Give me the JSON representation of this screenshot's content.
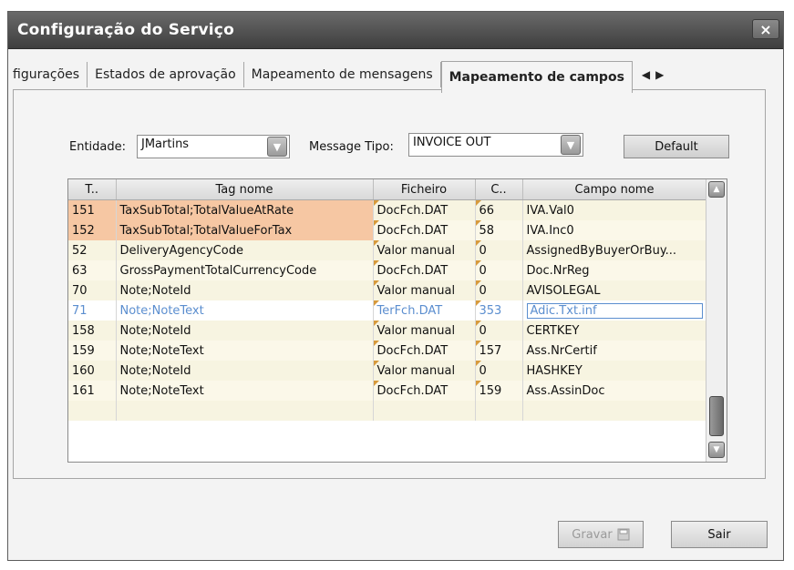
{
  "window": {
    "title": "Configuração do Serviço",
    "close_label": "×"
  },
  "tabs": [
    {
      "label": "figurações"
    },
    {
      "label": "Estados de aprovação"
    },
    {
      "label": "Mapeamento de mensagens"
    },
    {
      "label": "Mapeamento de campos",
      "active": true
    }
  ],
  "tab_scroll": {
    "left": "◀",
    "right": "▶"
  },
  "form": {
    "entidade_label": "Entidade:",
    "entidade_value": "JMartins",
    "message_tipo_label": "Message Tipo:",
    "message_tipo_value": "INVOICE OUT",
    "default_label": "Default"
  },
  "grid": {
    "columns": [
      "T..",
      "Tag nome",
      "Ficheiro",
      "C..",
      "Campo nome"
    ],
    "rows": [
      {
        "t": "151",
        "tag": "TaxSubTotal;TotalValueAtRate",
        "ficheiro": "DocFch.DAT",
        "c": "66",
        "campo": "IVA.Val0",
        "highlight": true
      },
      {
        "t": "152",
        "tag": "TaxSubTotal;TotalValueForTax",
        "ficheiro": "DocFch.DAT",
        "c": "58",
        "campo": "IVA.Inc0",
        "highlight": true
      },
      {
        "t": "52",
        "tag": "DeliveryAgencyCode",
        "ficheiro": "Valor manual",
        "c": "0",
        "campo": "AssignedByBuyerOrBuy..."
      },
      {
        "t": "63",
        "tag": "GrossPaymentTotalCurrencyCode",
        "ficheiro": "DocFch.DAT",
        "c": "0",
        "campo": "Doc.NrReg"
      },
      {
        "t": "70",
        "tag": "Note;NoteId",
        "ficheiro": "Valor manual",
        "c": "0",
        "campo": "AVISOLEGAL"
      },
      {
        "t": "71",
        "tag": "Note;NoteText",
        "ficheiro": "TerFch.DAT",
        "c": "353",
        "campo": "Adic.Txt.inf",
        "selected": true
      },
      {
        "t": "158",
        "tag": "Note;NoteId",
        "ficheiro": "Valor manual",
        "c": "0",
        "campo": "CERTKEY"
      },
      {
        "t": "159",
        "tag": "Note;NoteText",
        "ficheiro": "DocFch.DAT",
        "c": "157",
        "campo": "Ass.NrCertif"
      },
      {
        "t": "160",
        "tag": "Note;NoteId",
        "ficheiro": "Valor manual",
        "c": "0",
        "campo": "HASHKEY"
      },
      {
        "t": "161",
        "tag": "Note;NoteText",
        "ficheiro": "DocFch.DAT",
        "c": "159",
        "campo": "Ass.AssinDoc"
      }
    ]
  },
  "buttons": {
    "gravar": "Gravar",
    "sair": "Sair"
  },
  "colors": {
    "highlight": "#f6c7a3",
    "selected_text": "#5b8ecf",
    "titlebar": "#4a4a4a"
  }
}
